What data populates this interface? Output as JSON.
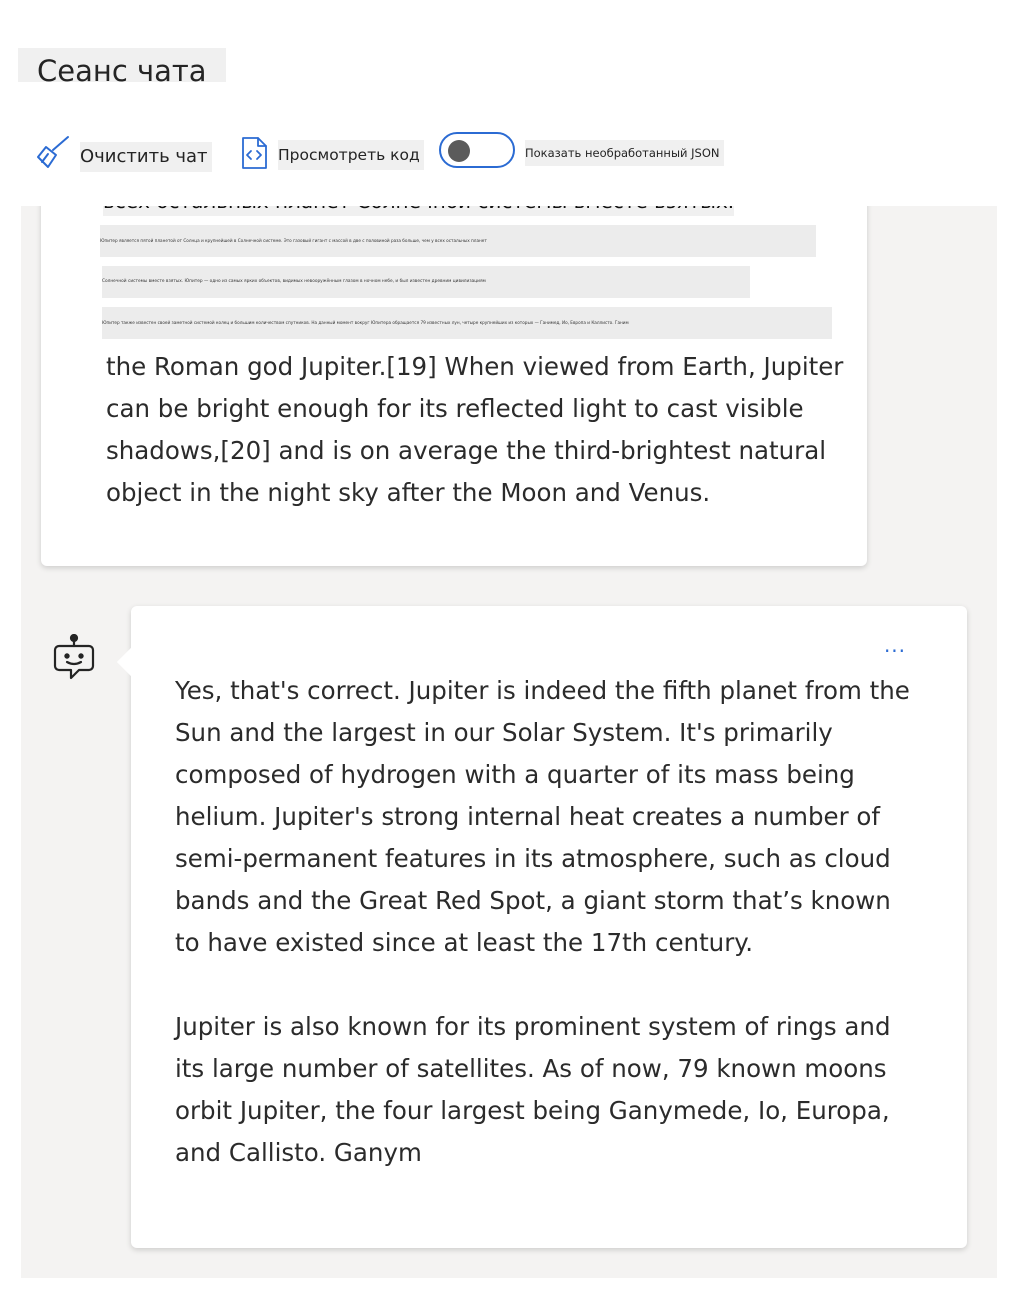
{
  "header": {
    "title": "Сеанс чата"
  },
  "toolbar": {
    "clear_label": "Очистить чат",
    "clear_icon": "broom-icon",
    "view_code_label": "Просмотреть код",
    "view_code_icon": "code-file-icon",
    "raw_json_label": "Показать необработанный JSON",
    "raw_json_enabled": false,
    "accent_color": "#2b6bd3"
  },
  "chat": {
    "user_message": {
      "visible_ru_line": "всех остальных планет Солнечной системы вместе взятых.",
      "partially_rendered_lines": [
        "Юпитер является пятой планетой от Солнца и крупнейшей в Солнечной системе. Это газовый гигант с массой в две с половиной раза больше, чем у всех остальных планет",
        "Солнечной системы вместе взятых. Юпитер — одно из самых ярких объектов, видимых невооружённым глазом в ночном небе, и был известен древним цивилизациям",
        "Юпитер также известен своей заметной системой колец и большим количеством спутников. На данный момент вокруг Юпитера обращается 79 известных лун, четыре крупнейших из которых — Ганимед, Ио, Европа и Каллисто. Ганим"
      ],
      "text": "the Roman god Jupiter.[19] When viewed from Earth, Jupiter can be bright enough for its reflected light to cast visible shadows,[20] and is on average the third-brightest natural object in the night sky after the Moon and Venus."
    },
    "bot_message": {
      "avatar_icon": "bot-icon",
      "more_label": "...",
      "paragraph_1": "Yes, that's correct. Jupiter is indeed the fifth planet from the Sun and the largest in our Solar System. It's primarily composed of hydrogen with a quarter of its mass being helium. Jupiter's strong internal heat creates a number of semi-permanent features in its atmosphere, such as cloud bands and the Great Red Spot, a giant storm that’s known to have existed since at least the 17th century.",
      "paragraph_2": "Jupiter is also known for its prominent system of rings and its large number of satellites. As of now, 79 known moons orbit Jupiter, the four largest being Ganymede, Io, Europa, and Callisto. Ganym"
    }
  }
}
